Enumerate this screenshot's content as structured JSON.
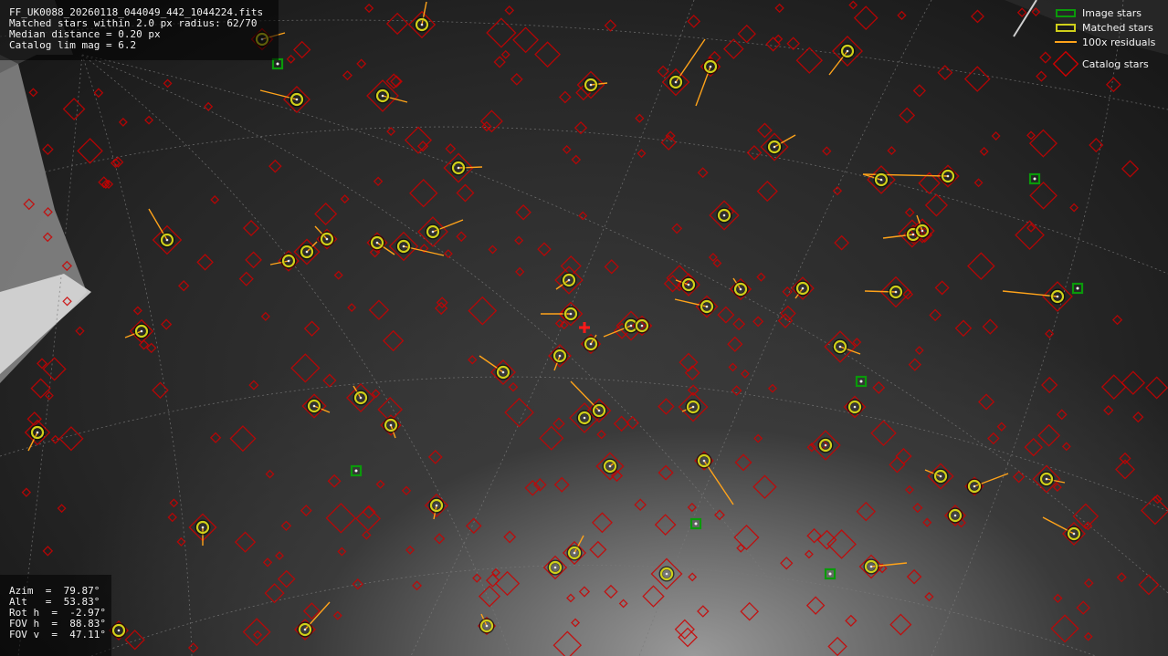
{
  "info": {
    "filename": "FF_UK0088_20260118_044049_442_1044224.fits",
    "matched": "Matched stars within 2.0 px radius: 62/70",
    "median": "Median distance = 0.20 px",
    "limmag": "Catalog lim mag = 6.2"
  },
  "pointing": {
    "azim": "Azim  =  79.87°",
    "alt": "Alt   =  53.83°",
    "roth": "Rot h  =  -2.97°",
    "fovh": "FOV h  =  88.83°",
    "fovv": "FOV v  =  47.11°"
  },
  "legend": {
    "image_stars": "Image stars",
    "matched_stars": "Matched stars",
    "residuals": "100x residuals",
    "catalog_stars": "Catalog stars"
  },
  "colors": {
    "image_star": "#0a9a0a",
    "matched_star": "#cfcf1a",
    "residual": "#ffa31a",
    "catalog_star": "#cc0000",
    "center_marker": "#ff1a1a"
  }
}
